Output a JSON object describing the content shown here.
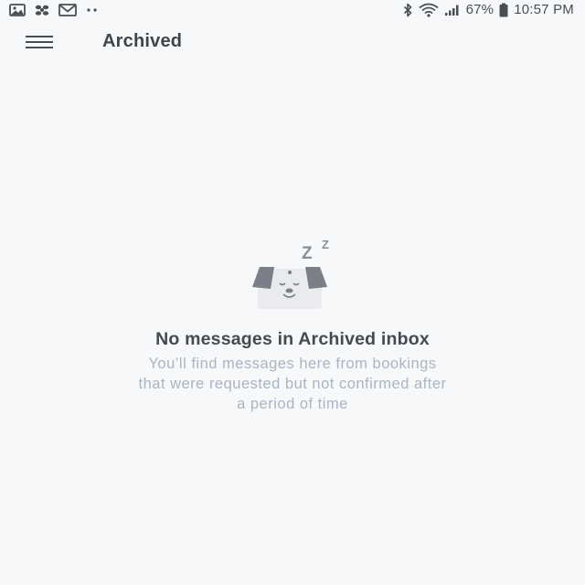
{
  "status_bar": {
    "left_icons": [
      "gallery-icon",
      "pinwheel-icon",
      "mail-icon",
      "more-dots-icon"
    ],
    "right_icons": [
      "bluetooth-icon",
      "wifi-icon",
      "signal-icon",
      "battery-icon"
    ],
    "battery": "67%",
    "time": "10:57 PM"
  },
  "app_bar": {
    "menu_icon": "hamburger-menu-icon",
    "title": "Archived"
  },
  "empty_state": {
    "illustration": "sleeping-dog-icon",
    "sleep_letters": [
      "Z",
      "Z"
    ],
    "title": "No messages in Archived inbox",
    "description_lines": [
      "You’ll find messages here from bookings",
      "that were requested but not confirmed after",
      "a period of time"
    ]
  },
  "colors": {
    "background": "#f7f8fa",
    "title_text": "#40444b",
    "muted_text": "#a9b5c3",
    "illustration": "#7a7f88"
  }
}
